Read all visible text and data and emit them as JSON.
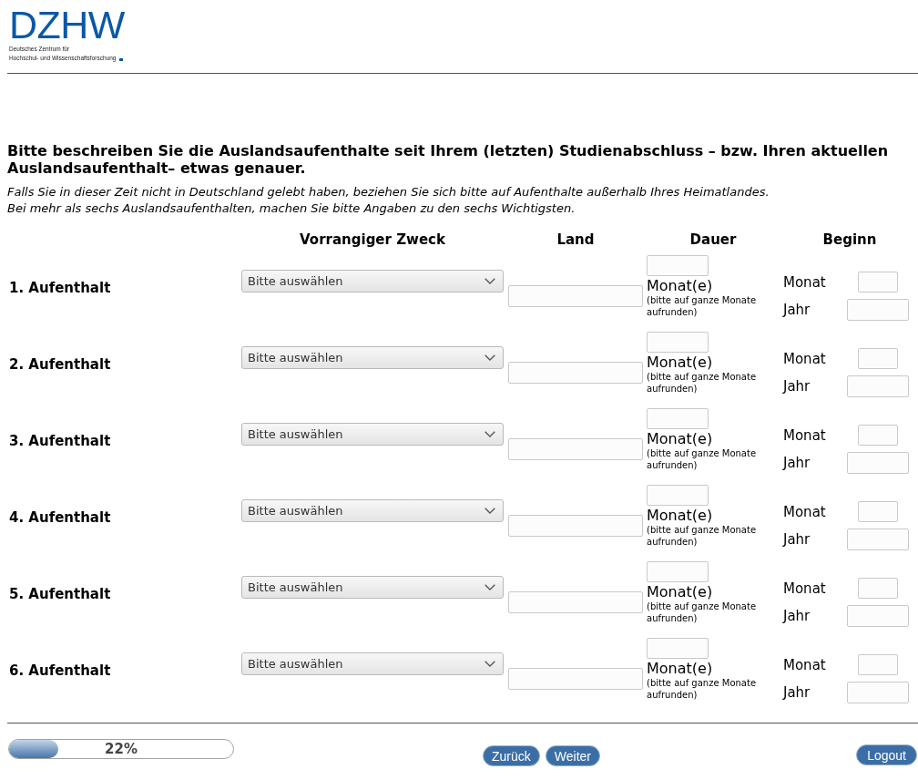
{
  "header": {
    "logo": {
      "wordmark": "DZHW",
      "tagline": [
        "Deutsches Zentrum für",
        "Hochschul- und Wissenschaftsforschung"
      ]
    }
  },
  "question": {
    "title": "Bitte beschreiben Sie die Auslandsaufenthalte seit Ihrem (letzten) Studienabschluss – bzw. Ihren aktuellen Auslandsaufenthalt– etwas genauer.",
    "notes": [
      "Falls Sie in dieser Zeit nicht in Deutschland gelebt haben, beziehen Sie sich bitte auf Aufenthalte außerhalb Ihres Heimatlandes.",
      "Bei mehr als sechs Auslandsaufenthalten, machen Sie bitte Angaben zu den sechs Wichtigsten."
    ]
  },
  "table": {
    "columns": [
      "Vorrangiger Zweck",
      "Land",
      "Dauer",
      "Beginn"
    ],
    "rows": [
      {
        "label": "1. Aufenthalt",
        "purpose": {
          "value": "Bitte auswählen"
        },
        "duration": {
          "unit": "Monat(e)",
          "hint": "(bitte auf ganze Monate aufrunden)"
        },
        "start": {
          "month_label": "Monat",
          "year_label": "Jahr"
        }
      },
      {
        "label": "2. Aufenthalt",
        "purpose": {
          "value": "Bitte auswählen"
        },
        "duration": {
          "unit": "Monat(e)",
          "hint": "(bitte auf ganze Monate aufrunden)"
        },
        "start": {
          "month_label": "Monat",
          "year_label": "Jahr"
        }
      },
      {
        "label": "3. Aufenthalt",
        "purpose": {
          "value": "Bitte auswählen"
        },
        "duration": {
          "unit": "Monat(e)",
          "hint": "(bitte auf ganze Monate aufrunden)"
        },
        "start": {
          "month_label": "Monat",
          "year_label": "Jahr"
        }
      },
      {
        "label": "4. Aufenthalt",
        "purpose": {
          "value": "Bitte auswählen"
        },
        "duration": {
          "unit": "Monat(e)",
          "hint": "(bitte auf ganze Monate aufrunden)"
        },
        "start": {
          "month_label": "Monat",
          "year_label": "Jahr"
        }
      },
      {
        "label": "5. Aufenthalt",
        "purpose": {
          "value": "Bitte auswählen"
        },
        "duration": {
          "unit": "Monat(e)",
          "hint": "(bitte auf ganze Monate aufrunden)"
        },
        "start": {
          "month_label": "Monat",
          "year_label": "Jahr"
        }
      },
      {
        "label": "6. Aufenthalt",
        "purpose": {
          "value": "Bitte auswählen"
        },
        "duration": {
          "unit": "Monat(e)",
          "hint": "(bitte auf ganze Monate aufrunden)"
        },
        "start": {
          "month_label": "Monat",
          "year_label": "Jahr"
        }
      }
    ]
  },
  "footer": {
    "progress": {
      "level": 0.22,
      "label": "22%"
    },
    "buttons": [
      {
        "label": "Zurück"
      },
      {
        "label": "Weiter"
      }
    ],
    "logout": {
      "label": "Logout"
    }
  }
}
